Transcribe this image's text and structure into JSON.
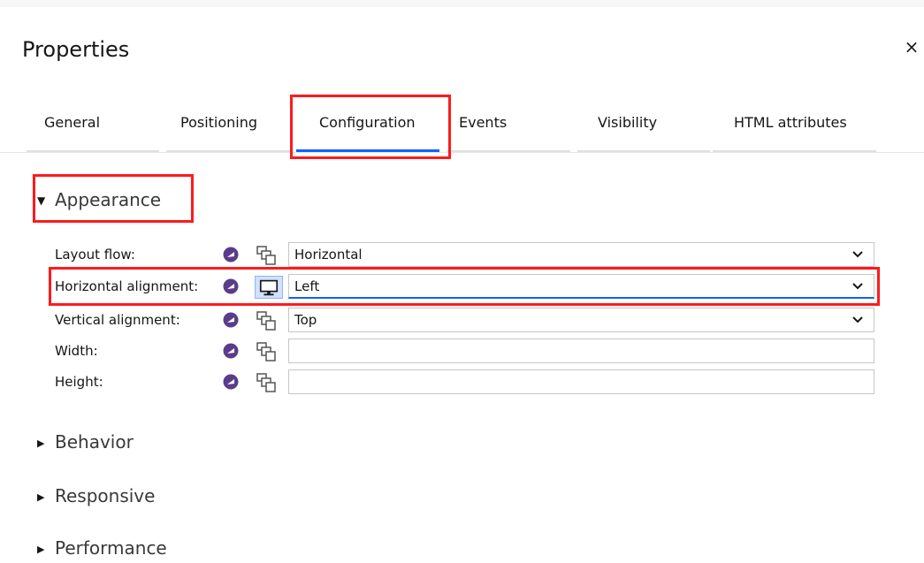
{
  "panel": {
    "title": "Properties",
    "close_label": "×"
  },
  "tabs": [
    {
      "label": "General",
      "active": false
    },
    {
      "label": "Positioning",
      "active": false
    },
    {
      "label": "Configuration",
      "active": true
    },
    {
      "label": "Events",
      "active": false
    },
    {
      "label": "Visibility",
      "active": false
    },
    {
      "label": "HTML attributes",
      "active": false
    }
  ],
  "sections": {
    "appearance": {
      "label": "Appearance",
      "expanded": true
    },
    "behavior": {
      "label": "Behavior",
      "expanded": false
    },
    "responsive": {
      "label": "Responsive",
      "expanded": false
    },
    "performance": {
      "label": "Performance",
      "expanded": false
    }
  },
  "appearance_rows": [
    {
      "label": "Layout flow:",
      "value": "Horizontal",
      "type": "select"
    },
    {
      "label": "Horizontal alignment:",
      "value": "Left",
      "type": "select"
    },
    {
      "label": "Vertical alignment:",
      "value": "Top",
      "type": "select"
    },
    {
      "label": "Width:",
      "value": "",
      "type": "text"
    },
    {
      "label": "Height:",
      "value": "",
      "type": "text"
    }
  ],
  "icons": {
    "bind": "variable-binding-icon",
    "screen": "screen-size-icon",
    "chevron": "chevron-down-icon",
    "caret_down": "caret-down-icon",
    "caret_right": "caret-right-icon"
  },
  "colors": {
    "accent": "#0f62fe",
    "highlight": "#ff1a1a",
    "bind_icon": "#5a3d8a",
    "screen_active": "#d0e2ff"
  }
}
